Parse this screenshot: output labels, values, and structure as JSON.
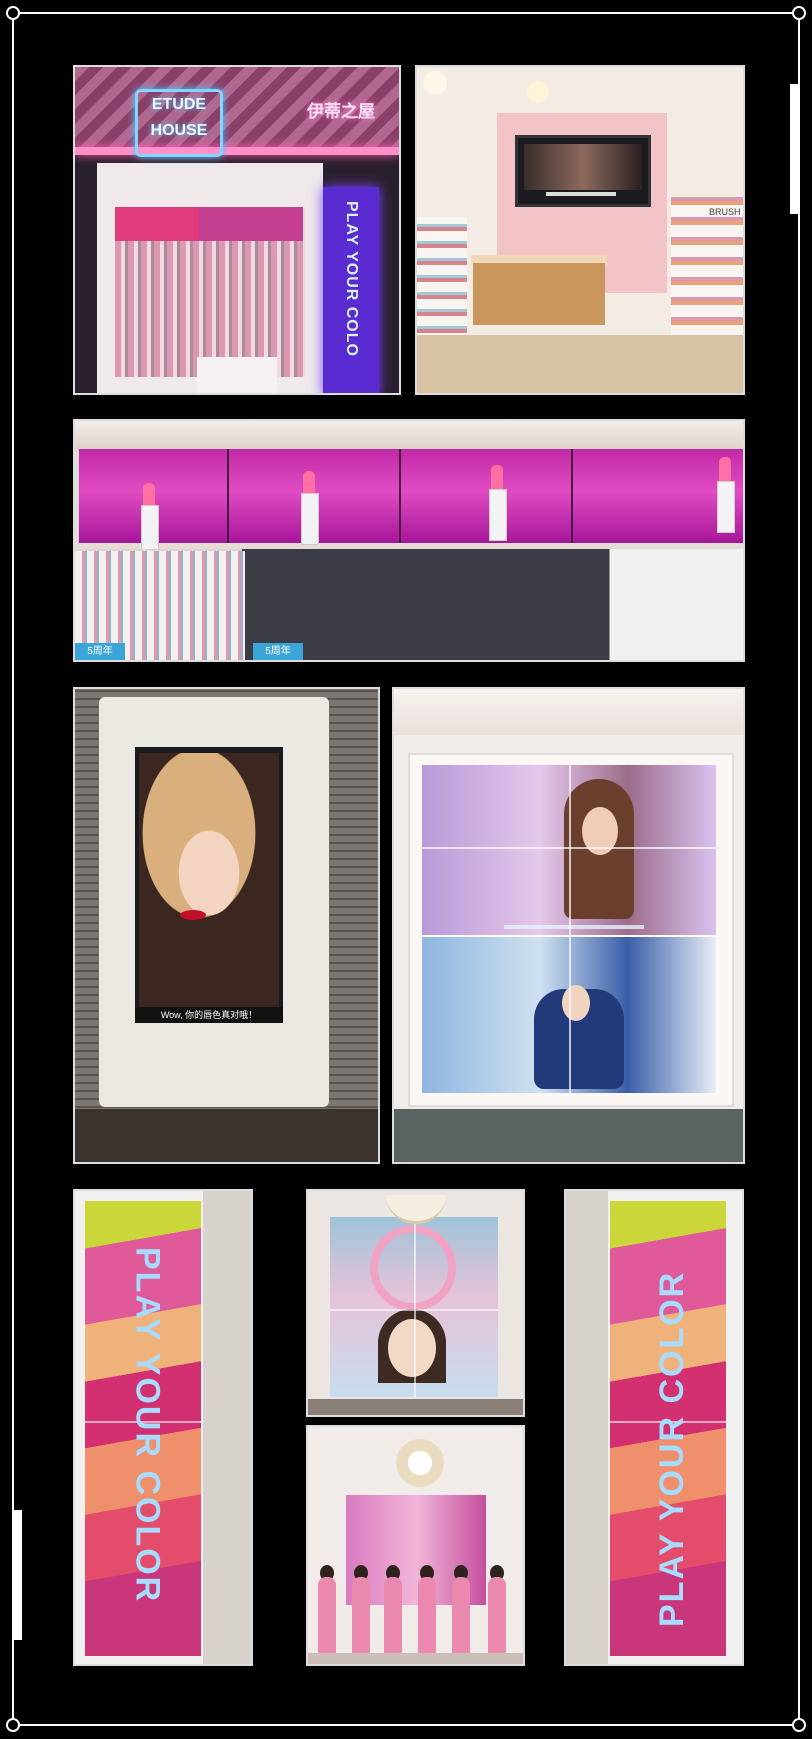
{
  "storefront": {
    "logo_line1": "ETUDE",
    "logo_line2": "HOUSE",
    "chinese_sign": "伊蒂之屋",
    "pillar_text": "PLAY YOUR COLO"
  },
  "interior": {
    "brush_label": "BRUSH"
  },
  "lipstick_wall": {
    "banner_left": "5周年",
    "banner_right": "5周年"
  },
  "portrait_screen": {
    "caption": "Wow, 你的唇色真对哦！"
  },
  "color_column_left": {
    "text": "PLAY YOUR COLOR"
  },
  "color_column_right": {
    "text": "PLAY YOUR COLOR"
  },
  "colors": {
    "background": "#000000",
    "frame": "#ffffff",
    "neon_pink": "#ff5fb0",
    "neon_blue": "#4fc6ff",
    "column_text": "#a8dcff"
  }
}
